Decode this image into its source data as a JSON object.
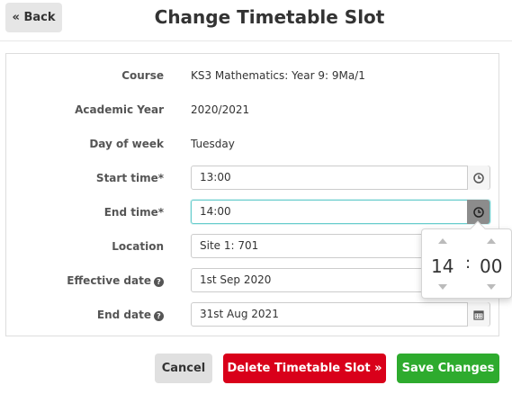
{
  "header": {
    "back_label": "« Back",
    "title": "Change Timetable Slot"
  },
  "fields": {
    "course": {
      "label": "Course",
      "value": "KS3 Mathematics: Year 9: 9Ma/1"
    },
    "academic_year": {
      "label": "Academic Year",
      "value": "2020/2021"
    },
    "day_of_week": {
      "label": "Day of week",
      "value": "Tuesday"
    },
    "start_time": {
      "label": "Start time*",
      "value": "13:00"
    },
    "end_time": {
      "label": "End time*",
      "value": "14:00"
    },
    "location": {
      "label": "Location",
      "value": "Site 1: 701"
    },
    "effective_date": {
      "label": "Effective date",
      "value": "1st Sep 2020"
    },
    "end_date": {
      "label": "End date",
      "value": "31st Aug 2021"
    }
  },
  "time_picker": {
    "hours": "14",
    "separator": ":",
    "minutes": "00"
  },
  "actions": {
    "cancel_label": "Cancel",
    "delete_label": "Delete Timetable Slot »",
    "save_label": "Save Changes"
  },
  "colors": {
    "delete": "#d9001a",
    "save": "#2eab2e",
    "focus": "#66cccc"
  }
}
